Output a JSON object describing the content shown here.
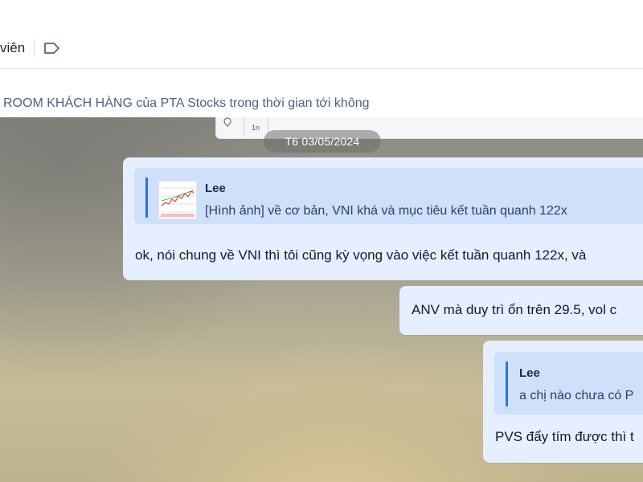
{
  "header": {
    "title_fragment": "viên"
  },
  "pinned": {
    "text": "ROOM KHÁCH HÀNG  của PTA Stocks trong thời gian tới không"
  },
  "peek_card": {
    "axis_label": "1n"
  },
  "chat": {
    "date_separator": "T6 03/05/2024",
    "messages": [
      {
        "quote": {
          "author": "Lee",
          "text": "[Hình ảnh] về cơ bản, VNI khá và mục tiêu kết tuần quanh 122x"
        },
        "text": "ok, nói chung về VNI thì tôi cũng kỳ vọng vào việc kết tuần quanh 122x, và"
      },
      {
        "text": "ANV mà duy trì ổn trên 29.5, vol c"
      },
      {
        "quote": {
          "author": "Lee",
          "text": "a chị nào chưa có P"
        },
        "text": "PVS đẩy tím được thì t"
      }
    ]
  },
  "colors": {
    "bubble": "#e5efff",
    "quote_bg": "#cfe0fb",
    "quote_bar": "#2f6fe4",
    "date_chip": "#6e6e69"
  }
}
